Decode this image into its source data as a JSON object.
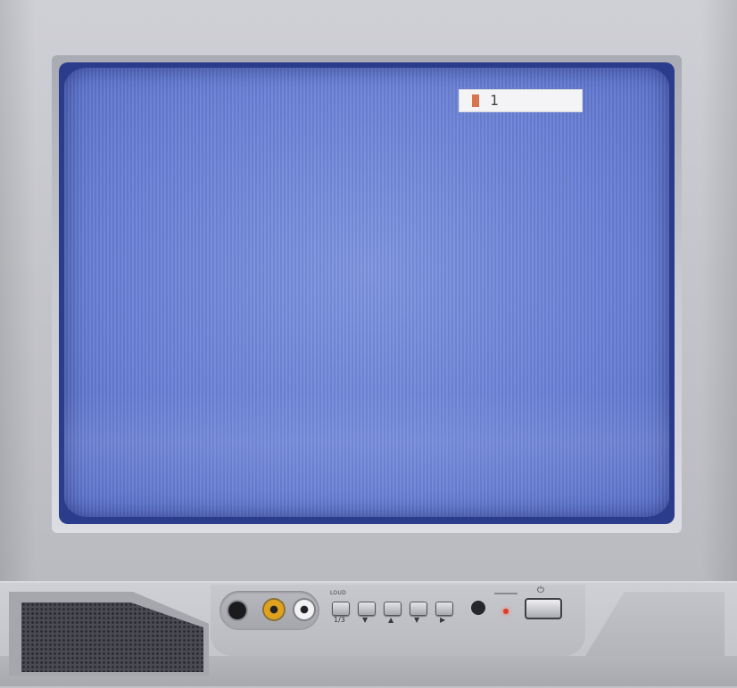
{
  "screen": {
    "osd_channel": "1",
    "screen_color": "#6b82d6",
    "osd_marker_color": "#d9734f"
  },
  "front_panel": {
    "jacks": [
      {
        "name": "headphone-jack",
        "color": "#1b1b1e"
      },
      {
        "name": "video-jack",
        "color": "#e0a21e"
      },
      {
        "name": "audio-jack",
        "color": "#f2f2f4"
      }
    ],
    "buttons": [
      {
        "top_label": "LOUD",
        "bottom_label": "1/3"
      },
      {
        "top_label": "",
        "bottom_label": "▼"
      },
      {
        "top_label": "",
        "bottom_label": "▲"
      },
      {
        "top_label": "",
        "bottom_label": "▼"
      },
      {
        "top_label": "",
        "bottom_label": "▶"
      }
    ],
    "power_symbol": "⏻",
    "led_color": "#e23a2a"
  }
}
